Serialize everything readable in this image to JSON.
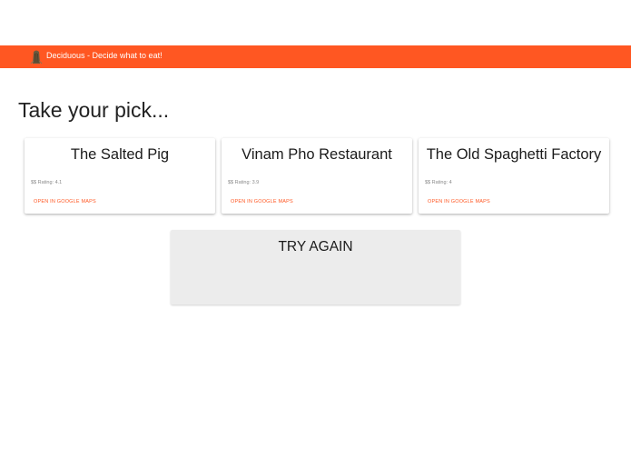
{
  "appbar": {
    "logo_icon": "tree-stump-icon",
    "title": "Deciduous - Decide what to eat!",
    "background": "#ff5722"
  },
  "main": {
    "heading": "Take your pick...",
    "restaurants": [
      {
        "name": "The Salted Pig",
        "meta": "$$ Rating: 4.1",
        "link_label": "OPEN IN GOOGLE MAPS"
      },
      {
        "name": "Vinam Pho Restaurant",
        "meta": "$$ Rating: 3.9",
        "link_label": "OPEN IN GOOGLE MAPS"
      },
      {
        "name": "The Old Spaghetti Factory",
        "meta": "$$ Rating: 4",
        "link_label": "OPEN IN GOOGLE MAPS"
      }
    ],
    "try_again_label": "TRY AGAIN"
  },
  "colors": {
    "accent": "#ff5722",
    "button_bg": "#ececec"
  }
}
